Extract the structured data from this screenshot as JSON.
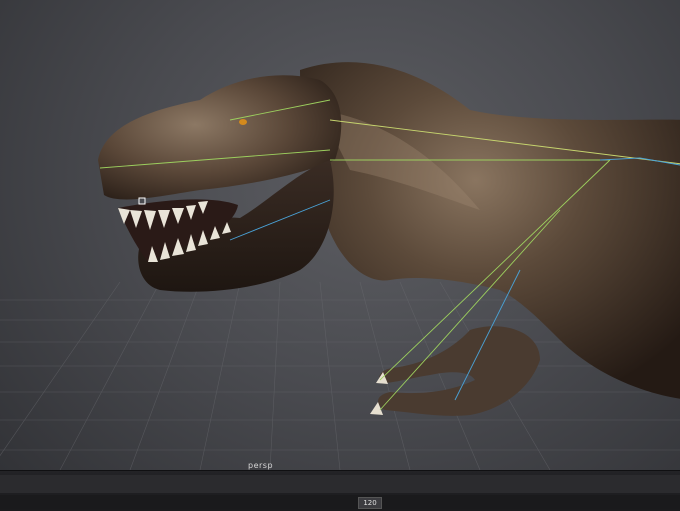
{
  "viewport": {
    "camera_label": "persp"
  },
  "timeline": {
    "tick_labels": [
      "",
      "",
      "",
      "",
      "",
      "",
      "",
      "",
      "",
      "",
      "",
      "",
      ""
    ],
    "frame_field": "120"
  },
  "colors": {
    "background": "#4a4b50",
    "skin": "#4a3a2e",
    "grid": "#6a6b70",
    "rig_green": "#9ccf5e",
    "rig_blue": "#4aa3d8"
  }
}
